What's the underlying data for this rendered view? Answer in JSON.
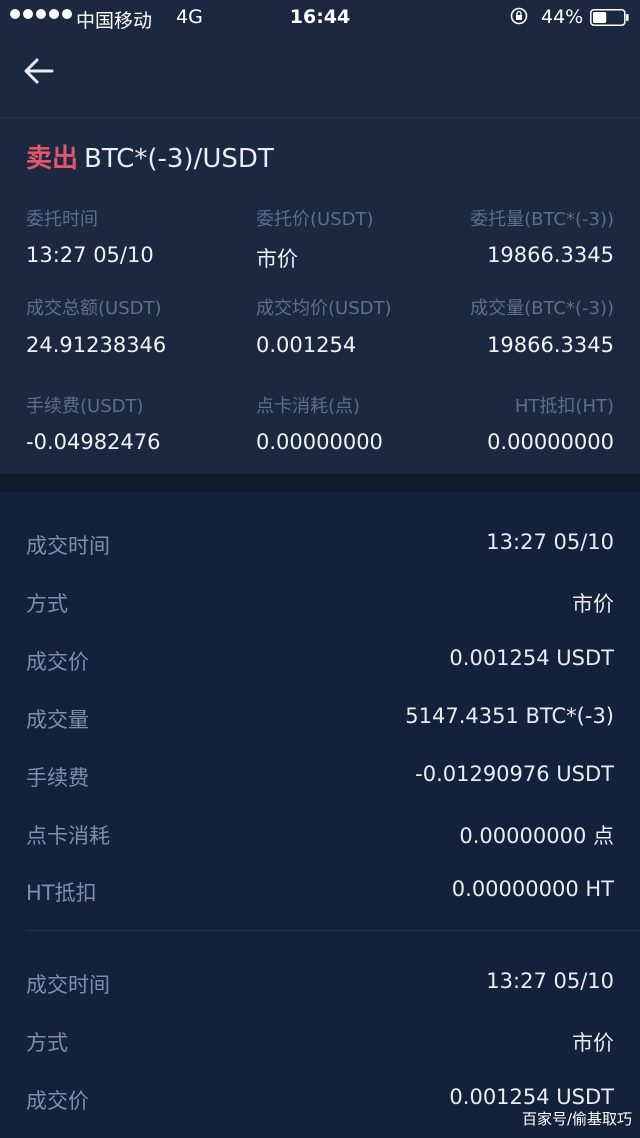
{
  "status_bar": {
    "carrier": "中国移动",
    "network": "4G",
    "time": "16:44",
    "battery_percent": "44%",
    "signal_dots": 5,
    "battery_level": 0.44
  },
  "header": {
    "back_icon": "arrow-left-icon"
  },
  "order": {
    "side": "卖出",
    "pair": "BTC*(-3)/USDT",
    "side_color": "#e0566b",
    "fields": [
      {
        "label": "委托时间",
        "value": "13:27 05/10"
      },
      {
        "label": "委托价(USDT)",
        "value": "市价"
      },
      {
        "label": "委托量(BTC*(-3))",
        "value": "19866.3345"
      },
      {
        "label": "成交总额(USDT)",
        "value": "24.91238346"
      },
      {
        "label": "成交均价(USDT)",
        "value": "0.001254"
      },
      {
        "label": "成交量(BTC*(-3))",
        "value": "19866.3345"
      },
      {
        "label": "手续费(USDT)",
        "value": "-0.04982476"
      },
      {
        "label": "点卡消耗(点)",
        "value": "0.00000000"
      },
      {
        "label": "HT抵扣(HT)",
        "value": "0.00000000"
      }
    ]
  },
  "trades": [
    {
      "rows": [
        {
          "label": "成交时间",
          "value": "13:27 05/10"
        },
        {
          "label": "方式",
          "value": "市价"
        },
        {
          "label": "成交价",
          "value": "0.001254 USDT"
        },
        {
          "label": "成交量",
          "value": "5147.4351 BTC*(-3)"
        },
        {
          "label": "手续费",
          "value": "-0.01290976 USDT"
        },
        {
          "label": "点卡消耗",
          "value": "0.00000000 点"
        },
        {
          "label": "HT抵扣",
          "value": "0.00000000 HT"
        }
      ]
    },
    {
      "rows": [
        {
          "label": "成交时间",
          "value": "13:27 05/10"
        },
        {
          "label": "方式",
          "value": "市价"
        },
        {
          "label": "成交价",
          "value": "0.001254 USDT"
        }
      ]
    }
  ],
  "watermark": "百家号/偷基取巧"
}
